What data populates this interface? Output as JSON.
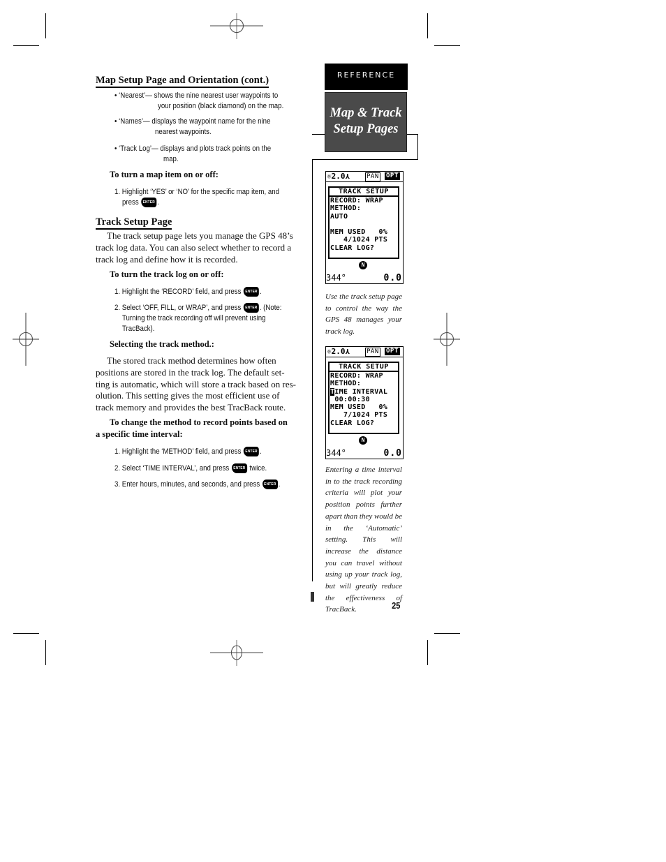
{
  "section1": {
    "heading": "Map Setup Page and Orientation (cont.)",
    "bullets": [
      {
        "l1": "• ‘Nearest’— shows the nine nearest user waypoints to",
        "l2": "your position (black diamond) on the map."
      },
      {
        "l1": "• ‘Names’— displays the waypoint name for the nine",
        "l2": "nearest waypoints."
      },
      {
        "l1": "• ‘Track Log’— displays and plots track points on the",
        "l2": "map."
      }
    ],
    "sub": "To turn a map item on or off:",
    "step1_l1": "1. Highlight ‘YES’ or ‘NO’ for the specific map item, and",
    "step1_l2a": "press",
    "step1_l2b": "."
  },
  "section2": {
    "heading": "Track Setup Page",
    "intro": [
      "  The track setup page lets you manage the GPS 48’s",
      "track log data.  You can also select whether to record a",
      "track log and define how it is recorded."
    ],
    "sub1": "To turn the track log on or off:",
    "steps1": [
      {
        "a": "1. Highlight the ‘RECORD’ field, and press",
        "b": "."
      },
      {
        "a": "2. Select ‘OFF, FILL, or WRAP’, and press",
        "b": ".  (Note:",
        "l2": "Turning the track recording off will prevent using",
        "l3": "TracBack)."
      }
    ],
    "sub2": "Selecting the track method.:",
    "method_para": [
      "  The stored track method determines how often",
      "positions are stored in the track log.  The default set-",
      "ting is automatic, which will store a track based on res-",
      "olution.  This setting gives the most efficient use of",
      "track memory and provides the best TracBack route."
    ],
    "sub3_l1": "To change the method to record points based on",
    "sub3_l2": "a specific time interval:",
    "steps2": [
      {
        "a": "1. Highlight the ‘METHOD’ field, and press",
        "b": "."
      },
      {
        "a": "2. Select ‘TIME INTERVAL’, and press",
        "b": " twice."
      },
      {
        "a": "3. Enter hours, minutes, and seconds, and press",
        "b": "."
      }
    ],
    "enter_key_label": "ENTER"
  },
  "sidebar": {
    "tab_label": "REFERENCE",
    "title_l1": "Map & Track",
    "title_l2": "Setup Pages",
    "caption1": "Use the track setup page to control the way the GPS 48 manages your track log.",
    "caption2": "Entering a time interval in to the track recording criteria will plot your position points further apart than they would be in the ‘Automatic’ setting. This will increase the distance you can travel without using up your track log, but will greatly reduce the effectiveness of TracBack."
  },
  "screen1": {
    "zoom": "2.0",
    "pan": "PAN",
    "opt": "OPT",
    "title": "TRACK SETUP",
    "lines": [
      "RECORD: WRAP",
      "METHOD:",
      "AUTO",
      "",
      "MEM USED   0%",
      "   4/1024 PTS",
      "CLEAR LOG?"
    ],
    "heading": "344°",
    "speed": "0.0",
    "north": "N"
  },
  "screen2": {
    "zoom": "2.0",
    "pan": "PAN",
    "opt": "OPT",
    "title": "TRACK SETUP",
    "lines": [
      "RECORD: WRAP",
      "METHOD:",
      "TIME INTERVAL",
      " 00:00:30",
      "MEM USED   0%",
      "   7/1024 PTS",
      "CLEAR LOG?"
    ],
    "heading": "344°",
    "speed": "0.0",
    "north": "N"
  },
  "page_number": "25"
}
